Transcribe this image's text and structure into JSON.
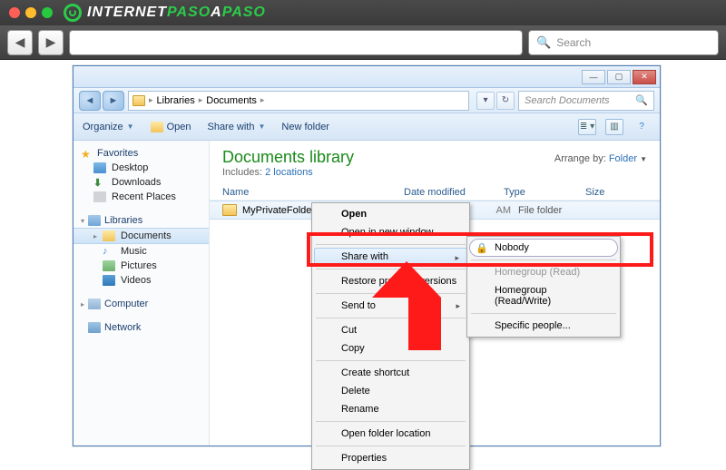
{
  "browser": {
    "logo_part1": "INTERNET",
    "logo_part2": "PASO",
    "logo_part3": "A",
    "logo_part4": "PASO",
    "search_placeholder": "Search"
  },
  "explorer": {
    "breadcrumbs": {
      "root": "Libraries",
      "current": "Documents"
    },
    "search_placeholder": "Search Documents",
    "toolbar": {
      "organize": "Organize",
      "open": "Open",
      "share_with": "Share with",
      "new_folder": "New folder"
    },
    "sidebar": {
      "favorites": {
        "label": "Favorites",
        "items": [
          "Desktop",
          "Downloads",
          "Recent Places"
        ]
      },
      "libraries": {
        "label": "Libraries",
        "items": [
          "Documents",
          "Music",
          "Pictures",
          "Videos"
        ]
      },
      "computer": "Computer",
      "network": "Network"
    },
    "library": {
      "title": "Documents library",
      "includes_label": "Includes:",
      "locations": "2 locations",
      "arrange_label": "Arrange by:",
      "arrange_value": "Folder"
    },
    "columns": {
      "name": "Name",
      "modified": "Date modified",
      "type": "Type",
      "size": "Size"
    },
    "row": {
      "name": "MyPrivateFolder",
      "modified_suffix": "AM",
      "type": "File folder"
    },
    "context_menu": {
      "open": "Open",
      "open_new": "Open in new window",
      "share_with": "Share with",
      "restore": "Restore previous versions",
      "send_to": "Send to",
      "cut": "Cut",
      "copy": "Copy",
      "shortcut": "Create shortcut",
      "delete": "Delete",
      "rename": "Rename",
      "open_loc": "Open folder location",
      "properties": "Properties"
    },
    "share_submenu": {
      "nobody": "Nobody",
      "hg_read": "Homegroup (Read)",
      "hg_rw": "Homegroup (Read/Write)",
      "specific": "Specific people..."
    }
  }
}
